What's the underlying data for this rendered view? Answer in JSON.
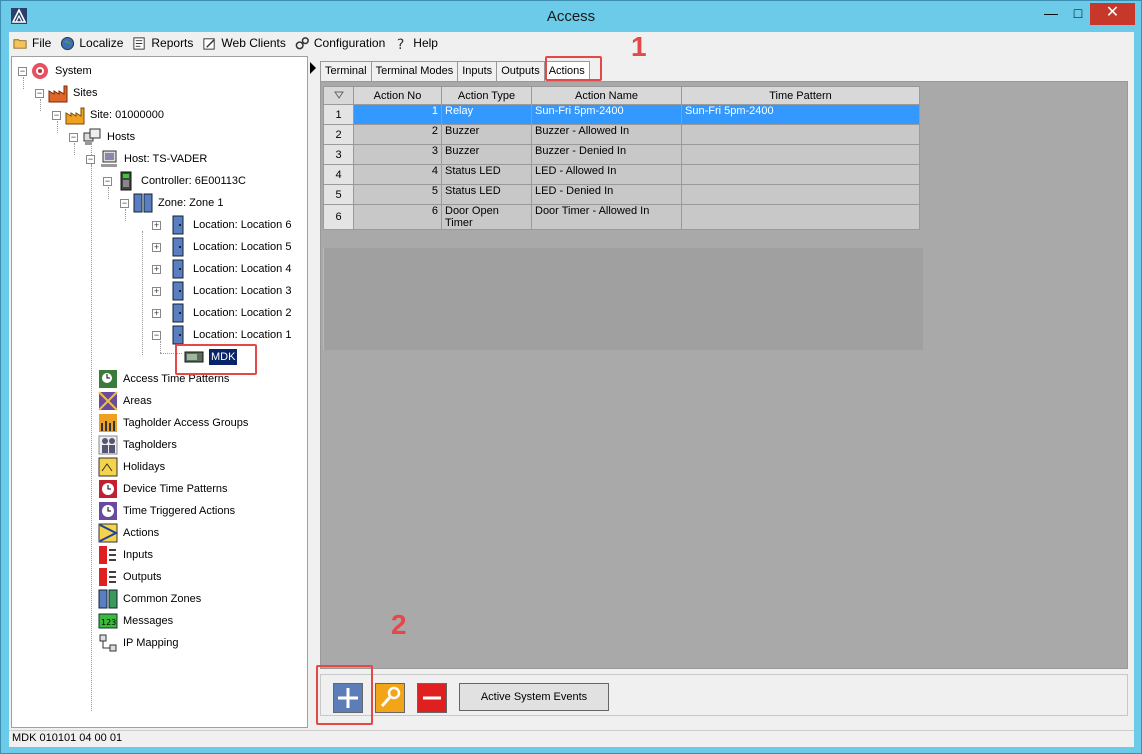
{
  "window": {
    "title": "Access"
  },
  "menu": [
    {
      "label": "File",
      "icon": "folder-icon"
    },
    {
      "label": "Localize",
      "icon": "globe-icon"
    },
    {
      "label": "Reports",
      "icon": "report-icon"
    },
    {
      "label": "Web Clients",
      "icon": "web-client-icon"
    },
    {
      "label": "Configuration",
      "icon": "gears-icon"
    },
    {
      "label": "Help",
      "icon": "help-icon"
    }
  ],
  "tree": {
    "system": "System",
    "sites": "Sites",
    "site": "Site: 01000000",
    "hosts": "Hosts",
    "host": "Host: TS-VADER",
    "controller": "Controller: 6E00113C",
    "zone": "Zone: Zone 1",
    "locations": [
      "Location: Location 6",
      "Location: Location 5",
      "Location: Location 4",
      "Location: Location 3",
      "Location: Location 2",
      "Location: Location 1"
    ],
    "device": "MDK",
    "sections": [
      "Access Time Patterns",
      "Areas",
      "Tagholder Access Groups",
      "Tagholders",
      "Holidays",
      "Device Time Patterns",
      "Time Triggered Actions",
      "Actions",
      "Inputs",
      "Outputs",
      "Common Zones",
      "Messages",
      "IP Mapping"
    ]
  },
  "tabs": [
    "Terminal",
    "Terminal Modes",
    "Inputs",
    "Outputs",
    "Actions"
  ],
  "active_tab": "Actions",
  "grid": {
    "columns": [
      "Action No",
      "Action Type",
      "Action Name",
      "Time Pattern"
    ],
    "rows": [
      {
        "row": "1",
        "no": "1",
        "type": "Relay",
        "name": "Sun-Fri 5pm-2400",
        "pattern": "Sun-Fri 5pm-2400"
      },
      {
        "row": "2",
        "no": "2",
        "type": "Buzzer",
        "name": "Buzzer - Allowed In",
        "pattern": ""
      },
      {
        "row": "3",
        "no": "3",
        "type": "Buzzer",
        "name": "Buzzer - Denied In",
        "pattern": ""
      },
      {
        "row": "4",
        "no": "4",
        "type": "Status LED",
        "name": "LED - Allowed In",
        "pattern": ""
      },
      {
        "row": "5",
        "no": "5",
        "type": "Status LED",
        "name": "LED - Denied In",
        "pattern": ""
      },
      {
        "row": "6",
        "no": "6",
        "type": "Door Open Timer",
        "name": "Door Timer - Allowed In",
        "pattern": ""
      }
    ]
  },
  "buttons": {
    "active_system_events": "Active System Events"
  },
  "status": "MDK 010101 04 00 01",
  "callouts": {
    "one": "1",
    "two": "2"
  },
  "colors": {
    "titlebar": "#6ccbe8",
    "selection": "#3399ff",
    "callout": "#e54848"
  }
}
